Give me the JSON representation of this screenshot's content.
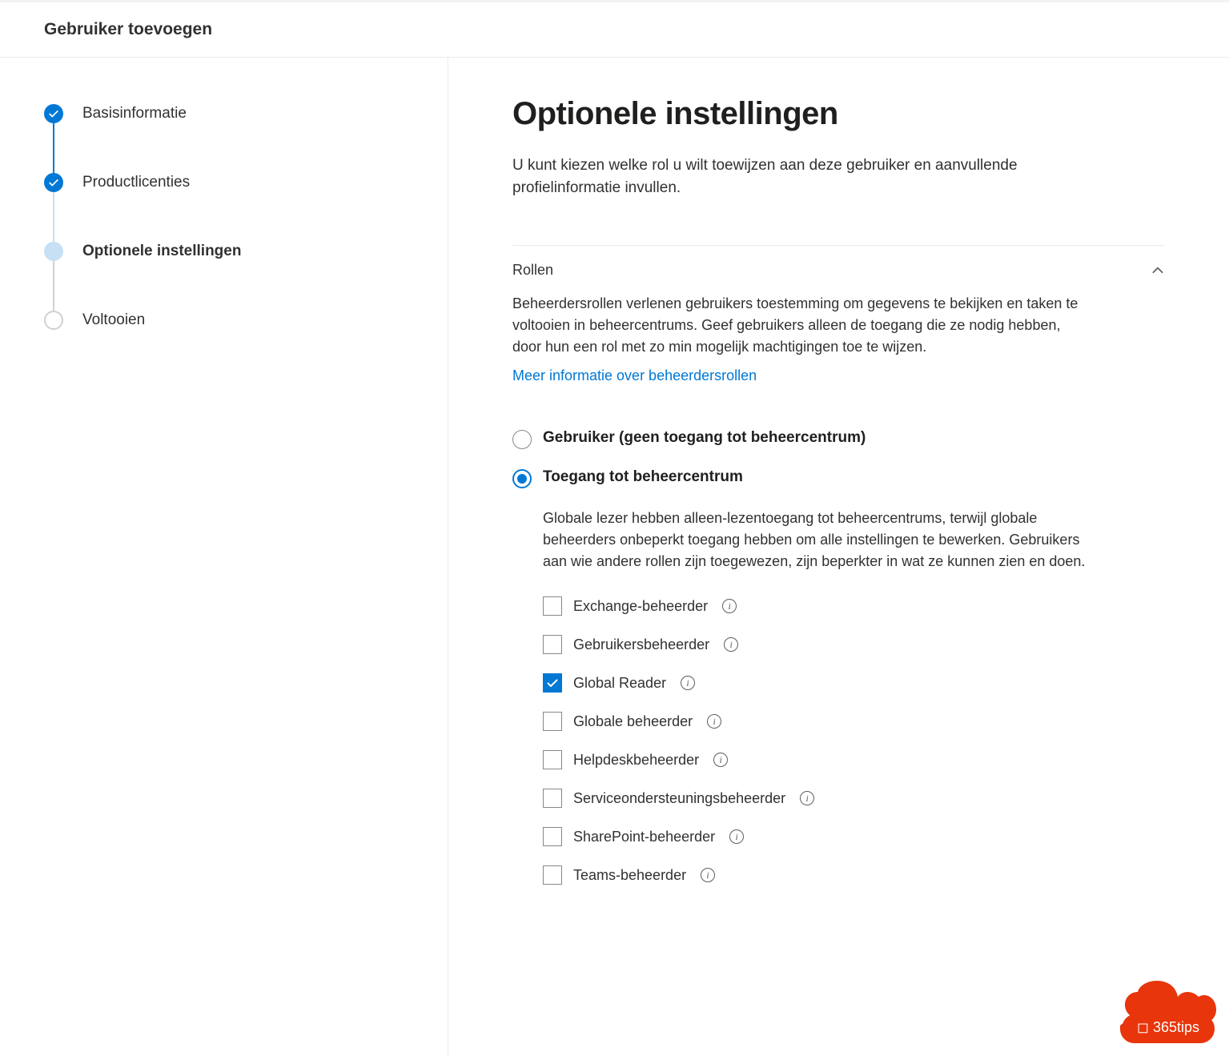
{
  "header": {
    "title": "Gebruiker toevoegen"
  },
  "stepper": [
    {
      "label": "Basisinformatie",
      "state": "done"
    },
    {
      "label": "Productlicenties",
      "state": "done"
    },
    {
      "label": "Optionele instellingen",
      "state": "current"
    },
    {
      "label": "Voltooien",
      "state": "future"
    }
  ],
  "main": {
    "heading": "Optionele instellingen",
    "intro": "U kunt kiezen welke rol u wilt toewijzen aan deze gebruiker en aanvullende profielinformatie invullen."
  },
  "roles_section": {
    "title": "Rollen",
    "body": "Beheerdersrollen verlenen gebruikers toestemming om gegevens te bekijken en taken te voltooien in beheercentrums. Geef gebruikers alleen de toegang die ze nodig hebben, door hun een rol met zo min mogelijk machtigingen toe te wijzen.",
    "link": "Meer informatie over beheerdersrollen",
    "radio_user": "Gebruiker (geen toegang tot beheercentrum)",
    "radio_admin": "Toegang tot beheercentrum",
    "radio_admin_desc": "Globale lezer hebben alleen-lezentoegang tot beheercentrums, terwijl globale beheerders onbeperkt toegang hebben om alle instellingen te bewerken. Gebruikers aan wie andere rollen zijn toegewezen, zijn beperkter in wat ze kunnen zien en doen.",
    "selected_radio": "admin",
    "roles": [
      {
        "label": "Exchange-beheerder",
        "checked": false
      },
      {
        "label": "Gebruikersbeheerder",
        "checked": false
      },
      {
        "label": "Global Reader",
        "checked": true
      },
      {
        "label": "Globale beheerder",
        "checked": false
      },
      {
        "label": "Helpdeskbeheerder",
        "checked": false
      },
      {
        "label": "Serviceondersteuningsbeheerder",
        "checked": false
      },
      {
        "label": "SharePoint-beheerder",
        "checked": false
      },
      {
        "label": "Teams-beheerder",
        "checked": false
      }
    ]
  },
  "badge": {
    "text": "365tips"
  }
}
